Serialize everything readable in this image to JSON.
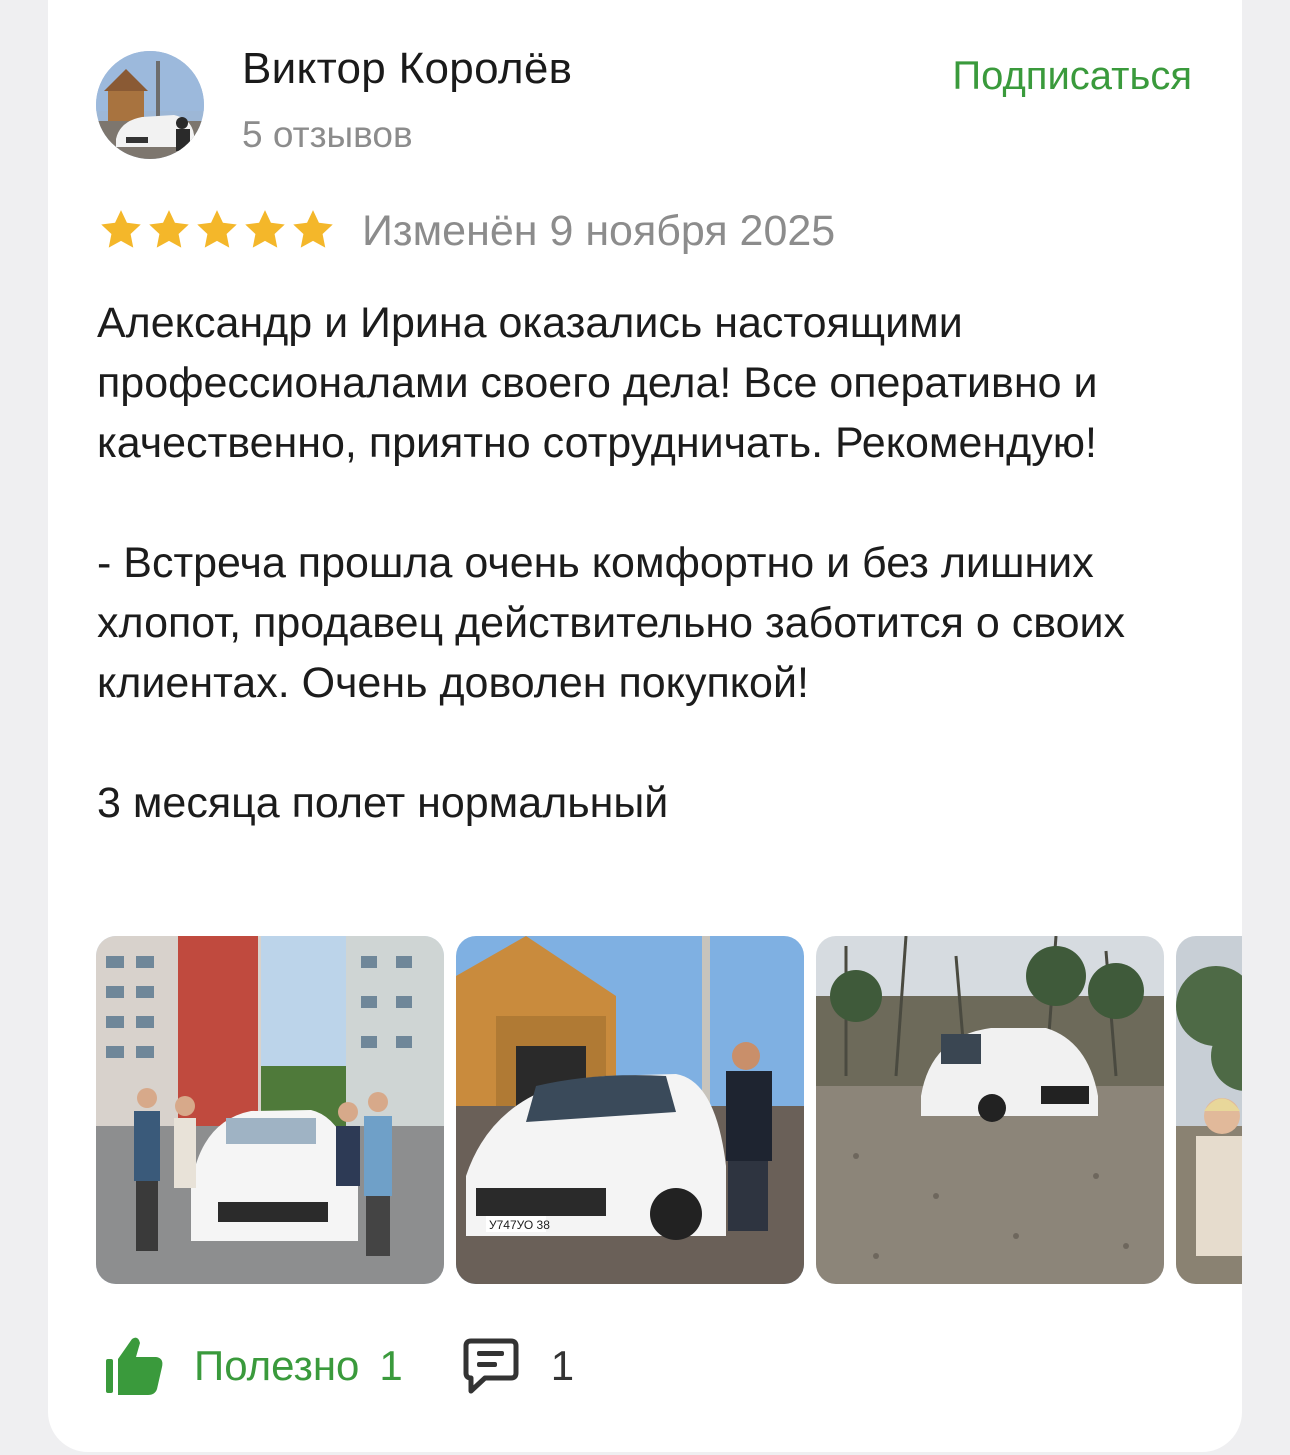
{
  "review": {
    "author": {
      "name": "Виктор Королёв",
      "reviews_count": "5 отзывов",
      "avatar_icon": "user-avatar-photo"
    },
    "subscribe_label": "Подписаться",
    "rating": 5,
    "date": "Изменён 9 ноября 2025",
    "text": "Александр и Ирина оказались настоящими профессионалами своего дела! Все оперативно и качественно, приятно сотрудничать. Рекомендую!\n\n- Встреча прошла очень комфортно и без лишних хлопот, продавец действительно заботится о своих клиентах. Очень доволен покупкой!\n\n3 месяца полет нормальный",
    "photos": [
      {
        "plate": ""
      },
      {
        "plate": "У747УО 38"
      },
      {
        "plate": ""
      },
      {
        "plate": ""
      }
    ],
    "helpful": {
      "label": "Полезно",
      "count": "1"
    },
    "comments": {
      "count": "1"
    }
  },
  "colors": {
    "accent_green": "#3a9a3c",
    "star": "#f4b72a",
    "muted_text": "#8c8c8c",
    "background": "#efeff1"
  }
}
